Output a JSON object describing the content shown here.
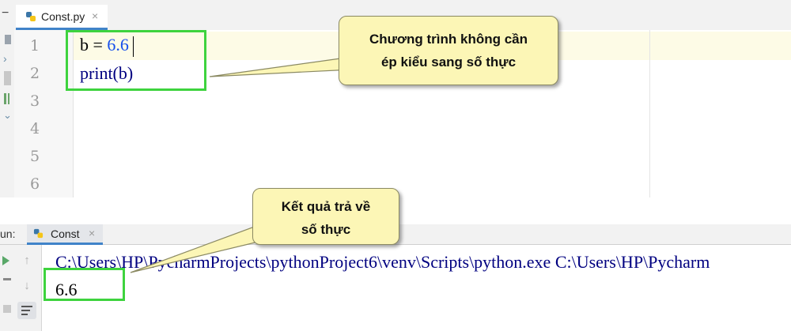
{
  "editor": {
    "tab_label": "Const.py",
    "tab_close": "×",
    "line_numbers": [
      "1",
      "2",
      "3",
      "4",
      "5",
      "6"
    ],
    "code": {
      "line1_var": "b = ",
      "line1_num": "6.6",
      "line2": "print(b)"
    }
  },
  "callouts": {
    "editor_note_line1": "Chương trình không cần",
    "editor_note_line2": "ép kiểu sang số thực",
    "output_note_line1": "Kết quả trả về",
    "output_note_line2": "số thực"
  },
  "run_panel": {
    "label": "un:",
    "tab_label": "Const",
    "tab_close": "×",
    "command": "C:\\Users\\HP\\PycharmProjects\\pythonProject6\\venv\\Scripts\\python.exe C:\\Users\\HP\\Pycharm",
    "output": "6.6"
  },
  "colors": {
    "highlight_box": "#3ed33e",
    "callout_fill": "#fcf6b6",
    "code_text": "#000080",
    "number_literal": "#1750eb"
  },
  "icons": [
    "python-file-icon",
    "close-icon",
    "up-arrow-icon",
    "down-arrow-icon",
    "soft-wrap-icon"
  ]
}
